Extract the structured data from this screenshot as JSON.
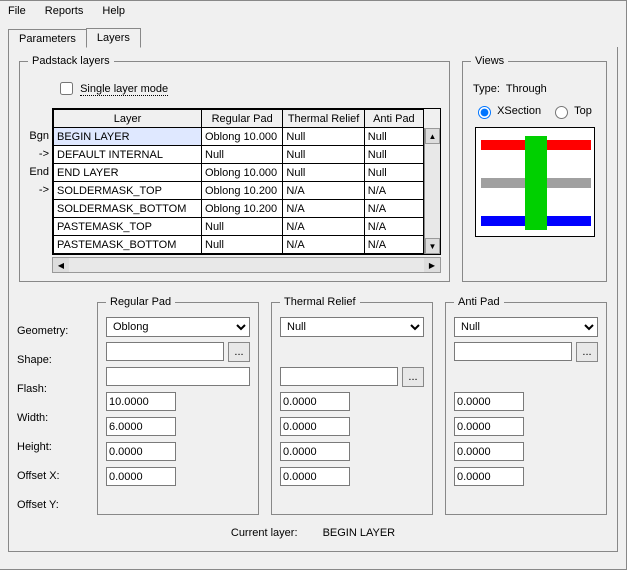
{
  "menu": {
    "file": "File",
    "reports": "Reports",
    "help": "Help"
  },
  "tabs": {
    "parameters": "Parameters",
    "layers": "Layers"
  },
  "padstack": {
    "legend": "Padstack layers",
    "slm_label": "Single layer mode",
    "columns": {
      "layer": "Layer",
      "regular": "Regular Pad",
      "thermal": "Thermal Relief",
      "anti": "Anti Pad"
    },
    "row_labels": [
      "Bgn",
      "->",
      "End",
      "->",
      "",
      "",
      ""
    ],
    "rows": [
      {
        "layer": "BEGIN LAYER",
        "regular": "Oblong 10.000",
        "thermal": "Null",
        "anti": "Null"
      },
      {
        "layer": "DEFAULT INTERNAL",
        "regular": "Null",
        "thermal": "Null",
        "anti": "Null"
      },
      {
        "layer": "END LAYER",
        "regular": "Oblong 10.000",
        "thermal": "Null",
        "anti": "Null"
      },
      {
        "layer": "SOLDERMASK_TOP",
        "regular": "Oblong 10.200",
        "thermal": "N/A",
        "anti": "N/A"
      },
      {
        "layer": "SOLDERMASK_BOTTOM",
        "regular": "Oblong 10.200",
        "thermal": "N/A",
        "anti": "N/A"
      },
      {
        "layer": "PASTEMASK_TOP",
        "regular": "Null",
        "thermal": "N/A",
        "anti": "N/A"
      },
      {
        "layer": "PASTEMASK_BOTTOM",
        "regular": "Null",
        "thermal": "N/A",
        "anti": "N/A"
      }
    ]
  },
  "views": {
    "legend": "Views",
    "type_label": "Type:",
    "type_value": "Through",
    "xsection": "XSection",
    "top": "Top"
  },
  "field_labels": {
    "geometry": "Geometry:",
    "shape": "Shape:",
    "flash": "Flash:",
    "width": "Width:",
    "height": "Height:",
    "offx": "Offset X:",
    "offy": "Offset Y:"
  },
  "regular_pad": {
    "legend": "Regular Pad",
    "geometry": "Oblong",
    "shape": "",
    "flash": "",
    "width": "10.0000",
    "height": "6.0000",
    "offx": "0.0000",
    "offy": "0.0000"
  },
  "thermal_relief": {
    "legend": "Thermal Relief",
    "geometry": "Null",
    "shape": "",
    "flash": "",
    "width": "0.0000",
    "height": "0.0000",
    "offx": "0.0000",
    "offy": "0.0000"
  },
  "anti_pad": {
    "legend": "Anti Pad",
    "geometry": "Null",
    "shape": "",
    "flash": "",
    "width": "0.0000",
    "height": "0.0000",
    "offx": "0.0000",
    "offy": "0.0000"
  },
  "current_layer": {
    "label": "Current layer:",
    "value": "BEGIN LAYER"
  },
  "dots": "..."
}
